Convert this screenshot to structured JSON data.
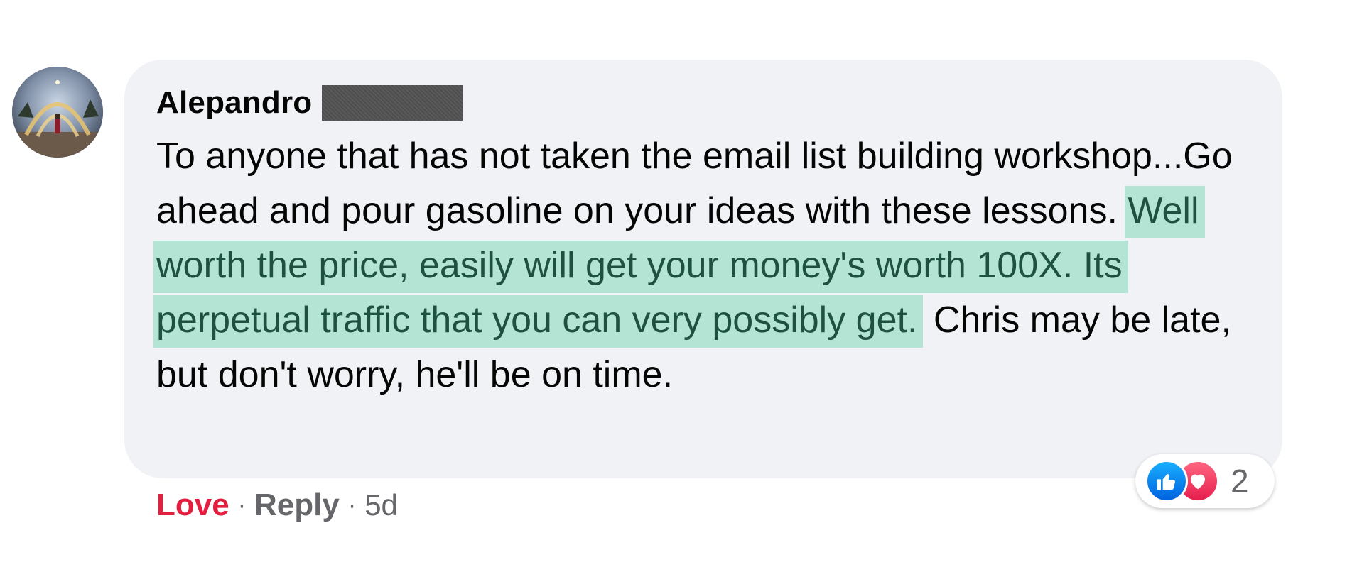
{
  "comment": {
    "author": "Alepandro",
    "text_before": "To anyone that has not taken the email list building workshop...Go ahead and pour gasoline on your ideas with these lessons. ",
    "text_highlighted": "Well worth the price, easily will get your money's worth 100X. Its perpetual traffic that you can very possibly get.",
    "text_after": " Chris may be late, but don't worry, he'll be on time."
  },
  "actions": {
    "love_label": "Love",
    "reply_label": "Reply",
    "separator": "·",
    "timestamp": "5d"
  },
  "reactions": {
    "types": [
      "like-icon",
      "love-icon"
    ],
    "count": "2"
  },
  "colors": {
    "bubble": "#f0f2f5",
    "highlight": "#b4e5d4",
    "highlight_text": "#1f5140",
    "love": "#e41e3f",
    "meta": "#65676b",
    "like": "#1877f2"
  }
}
